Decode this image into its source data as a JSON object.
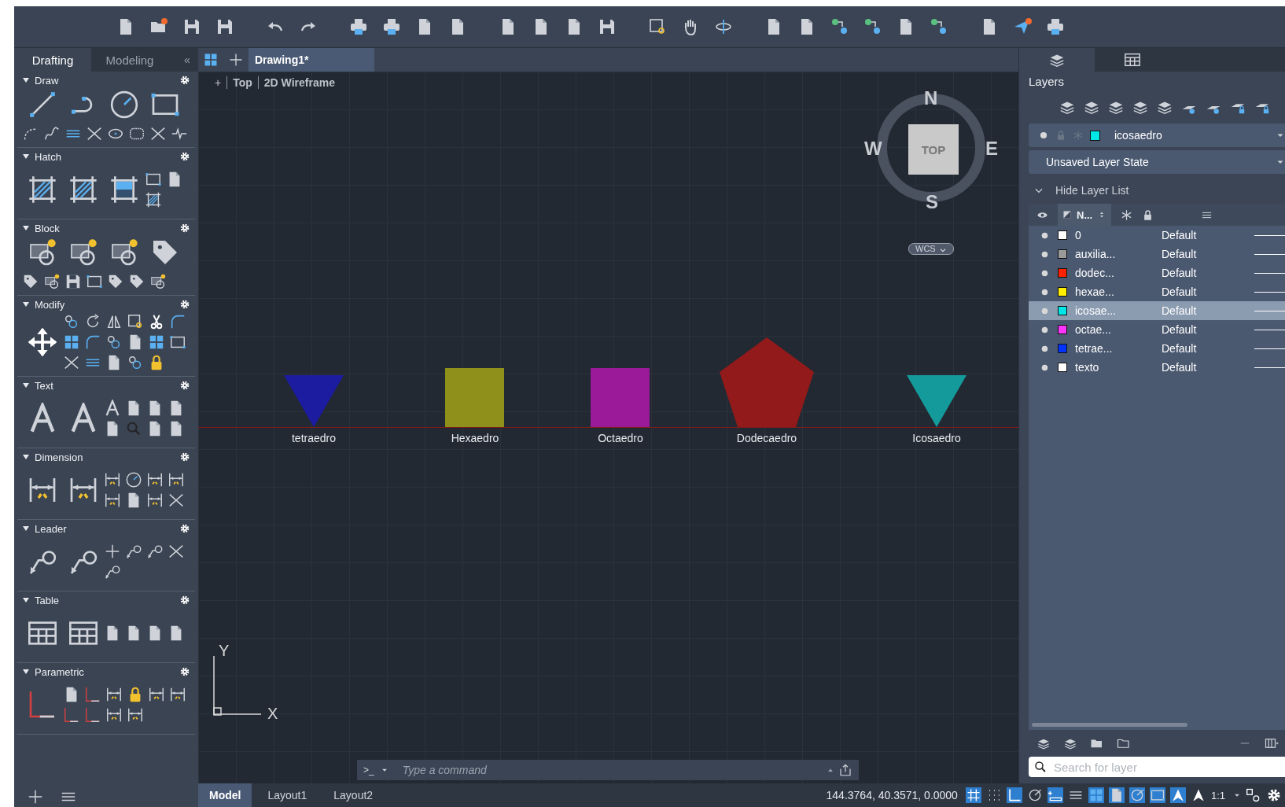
{
  "palette_tabs": [
    {
      "label": "Drafting",
      "selected": true
    },
    {
      "label": "Modeling",
      "selected": false
    }
  ],
  "collapse_button": "«",
  "palette_sections": [
    {
      "title": "Draw",
      "expanded": true
    },
    {
      "title": "Hatch",
      "expanded": true
    },
    {
      "title": "Block",
      "expanded": true
    },
    {
      "title": "Modify",
      "expanded": true
    },
    {
      "title": "Text",
      "expanded": true
    },
    {
      "title": "Dimension",
      "expanded": true
    },
    {
      "title": "Leader",
      "expanded": true
    },
    {
      "title": "Table",
      "expanded": true
    },
    {
      "title": "Parametric",
      "expanded": true
    }
  ],
  "document_tabs": [
    {
      "label": "Drawing1*",
      "selected": true
    }
  ],
  "viewport": {
    "controls": [
      "+",
      "Top",
      "2D Wireframe"
    ],
    "viewcube": {
      "face": "TOP",
      "north": "N",
      "south": "S",
      "east": "E",
      "west": "W",
      "ucs": "WCS"
    },
    "shapes": [
      {
        "kind": "triangle",
        "color": "#1c1ca0",
        "label": "tetraedro"
      },
      {
        "kind": "square",
        "color": "#8f8f1b",
        "label": "Hexaedro"
      },
      {
        "kind": "square",
        "color": "#9a1a9a",
        "label": "Octaedro"
      },
      {
        "kind": "pentagon",
        "color": "#921a1a",
        "label": "Dodecaedro"
      },
      {
        "kind": "triangle",
        "color": "#149a9a",
        "label": "Icosaedro"
      }
    ],
    "ucs_icon": {
      "x": "X",
      "y": "Y"
    }
  },
  "command_line": {
    "prompt": ">_",
    "placeholder": "Type a command"
  },
  "layout_tabs": [
    {
      "label": "Model",
      "selected": true
    },
    {
      "label": "Layout1",
      "selected": false
    },
    {
      "label": "Layout2",
      "selected": false
    }
  ],
  "status_bar": {
    "coordinates": "144.3764, 40.3571, 0.0000",
    "toggles": [
      {
        "on": true
      },
      {
        "on": false
      },
      {
        "on": true
      },
      {
        "on": false
      },
      {
        "on": true
      },
      {
        "on": false
      },
      {
        "on": true
      },
      {
        "on": true
      },
      {
        "on": true
      },
      {
        "on": true
      },
      {
        "on": true
      },
      {
        "on": false
      }
    ],
    "annotation_scale": "1:1"
  },
  "layers_panel": {
    "title": "Layers",
    "current_layer": {
      "name": "icosaedro",
      "color": "#00e5e5"
    },
    "layer_state": "Unsaved Layer State",
    "toggle_list": "Hide Layer List",
    "list_expanded": true,
    "name_column": "N...",
    "layers": [
      {
        "name": "0",
        "color": "#ffffff",
        "linetype": "Default",
        "selected": false
      },
      {
        "name": "auxilia...",
        "color": "#9a9a9a",
        "linetype": "Default",
        "selected": false
      },
      {
        "name": "dodec...",
        "color": "#ff2200",
        "linetype": "Default",
        "selected": false
      },
      {
        "name": "hexae...",
        "color": "#ffee00",
        "linetype": "Default",
        "selected": false
      },
      {
        "name": "icosae...",
        "color": "#00e5e5",
        "linetype": "Default",
        "selected": true
      },
      {
        "name": "octae...",
        "color": "#ff33ff",
        "linetype": "Default",
        "selected": false
      },
      {
        "name": "tetrae...",
        "color": "#0033ff",
        "linetype": "Default",
        "selected": false
      },
      {
        "name": "texto",
        "color": "#ffffff",
        "linetype": "Default",
        "selected": false
      }
    ],
    "search": {
      "placeholder": "Search for layer"
    }
  }
}
